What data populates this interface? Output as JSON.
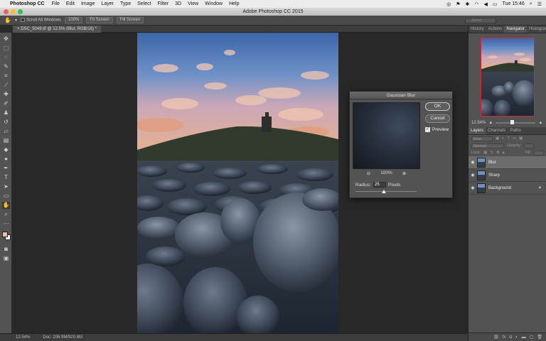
{
  "menubar": {
    "app_name": "Photoshop CC",
    "items": [
      "File",
      "Edit",
      "Image",
      "Layer",
      "Type",
      "Select",
      "Filter",
      "3D",
      "View",
      "Window",
      "Help"
    ],
    "clock": "Tue 15:46"
  },
  "window": {
    "title": "Adobe Photoshop CC 2015"
  },
  "options_bar": {
    "scroll_all_label": "Scroll All Windows",
    "btn_100": "100%",
    "btn_fit": "Fit Screen",
    "btn_fill": "Fill Screen",
    "search_placeholder": "James"
  },
  "document": {
    "tab_label": "DSC_5049.tif @ 12.5% (Blur, RGB/16) *",
    "zoom": "12.54%",
    "doc_size": "Doc: 206.9M/920.6M"
  },
  "panels": {
    "top_tabs": [
      "History",
      "Actions",
      "Navigator",
      "Histogram"
    ],
    "active_top_tab": "Navigator",
    "navigator_zoom": "12.54%",
    "navigator_zoom_fraction": 0.4,
    "layer_tabs": [
      "Layers",
      "Channels",
      "Paths"
    ],
    "kind_label": "Kind",
    "blend_mode": "Normal",
    "opacity_label": "Opacity:",
    "lock_label": "Lock:",
    "fill_label": "Fill:",
    "layers": [
      {
        "name": "Blur",
        "selected": true
      },
      {
        "name": "Sharp",
        "selected": false
      },
      {
        "name": "Background",
        "selected": false
      }
    ]
  },
  "dialog": {
    "title": "Gaussian Blur",
    "ok_label": "OK",
    "cancel_label": "Cancel",
    "preview_label": "Preview",
    "preview_checked": true,
    "zoom": "100%",
    "radius_label": "Radius:",
    "radius_value": "25",
    "radius_unit": "Pixels"
  },
  "colors": {
    "foreground": "#f2b8a6",
    "background": "#ffffff"
  }
}
